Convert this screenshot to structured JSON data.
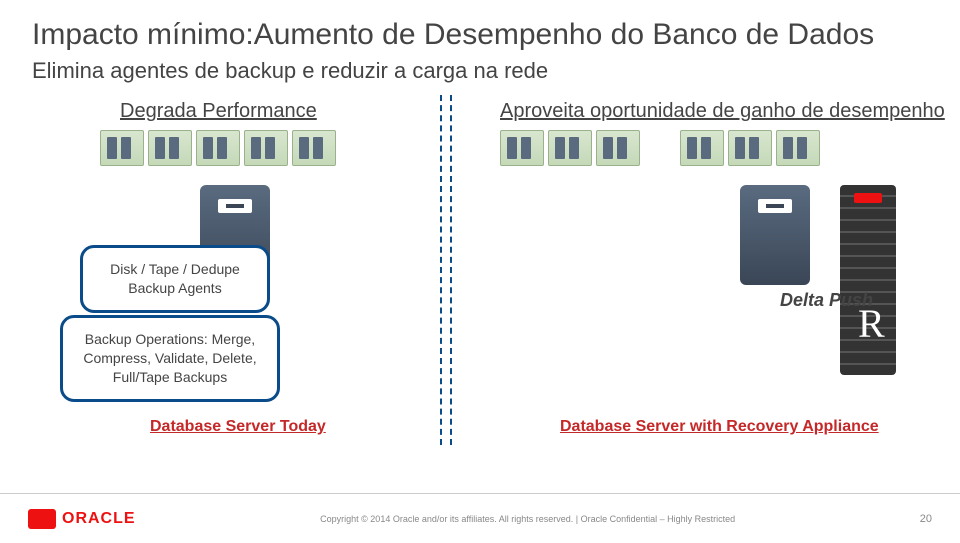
{
  "title": "Impacto mínimo:Aumento de Desempenho do Banco de Dados",
  "subtitle": "Elimina agentes de backup e reduzir a carga na rede",
  "left_header": "Degrada Performance",
  "right_header": "Aproveita oportunidade de ganho de desempenho",
  "bubble_agents": "Disk / Tape / Dedupe Backup Agents",
  "bubble_ops": "Backup Operations: Merge, Compress, Validate, Delete, Full/Tape Backups",
  "delta_label": "Delta Push",
  "appliance_letter": "R",
  "caption_left": "Database Server Today",
  "caption_right": "Database Server with Recovery Appliance",
  "footer": {
    "brand": "ORACLE",
    "copyright": "Copyright © 2014 Oracle and/or its affiliates. All rights reserved.   |   Oracle Confidential – Highly Restricted",
    "page": "20"
  }
}
